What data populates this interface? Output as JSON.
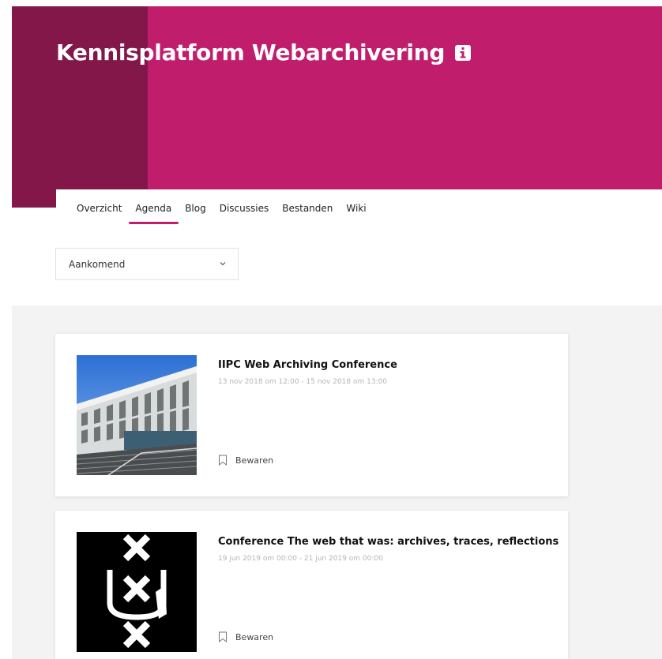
{
  "header": {
    "title": "Kennisplatform Webarchivering",
    "info_icon": "info-icon",
    "colors": {
      "primary": "#c01e6c",
      "dark": "#831749"
    }
  },
  "nav": {
    "tabs": [
      {
        "label": "Overzicht"
      },
      {
        "label": "Agenda",
        "active": true
      },
      {
        "label": "Blog"
      },
      {
        "label": "Discussies"
      },
      {
        "label": "Bestanden"
      },
      {
        "label": "Wiki"
      }
    ]
  },
  "filter": {
    "selected": "Aankomend",
    "icon": "chevron-down-icon"
  },
  "events": [
    {
      "title": "IIPC Web Archiving Conference",
      "date": "13 nov 2018 om 12:00 - 15 nov 2018 om 13:00",
      "save_label": "Bewaren",
      "image": "building-photo"
    },
    {
      "title": "Conference The web that was: archives, traces, reflections",
      "date": "19 jun 2019 om 00:00 - 21 jun 2019 om 00:00",
      "save_label": "Bewaren",
      "image": "uva-logo"
    }
  ]
}
